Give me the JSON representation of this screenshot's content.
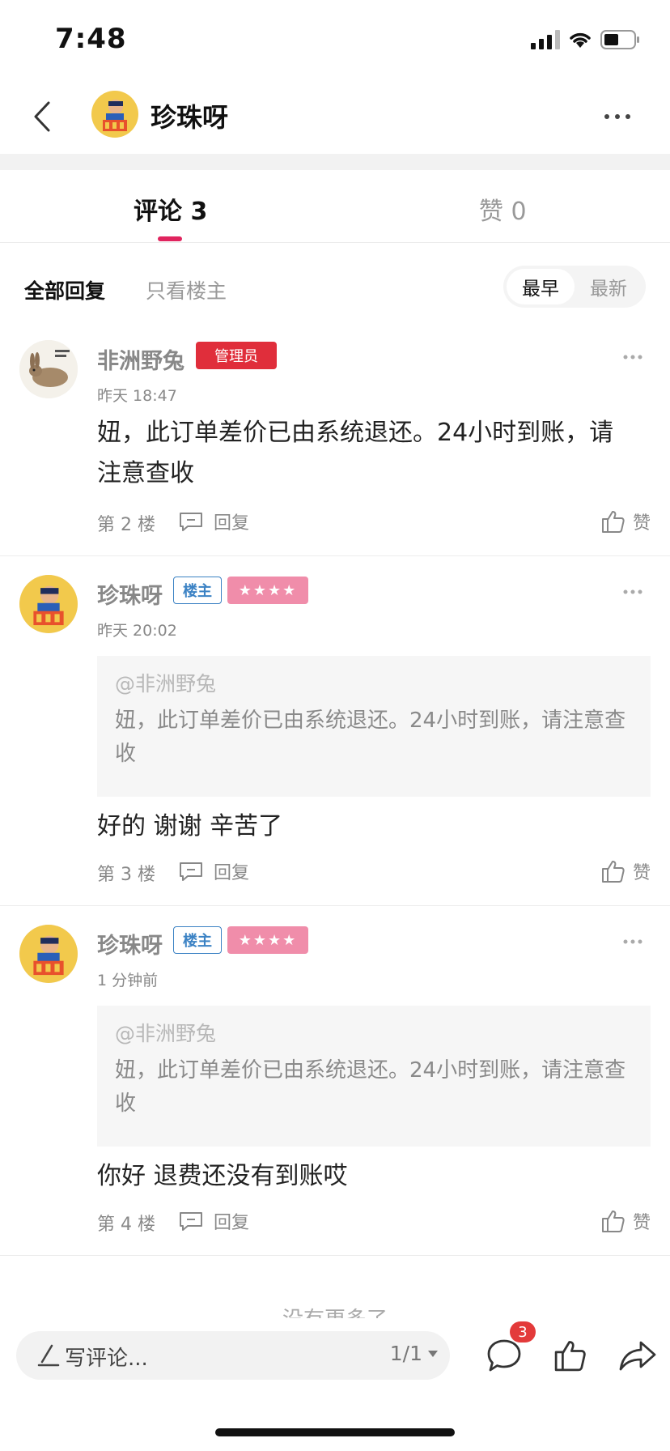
{
  "status_bar": {
    "time": "7:48"
  },
  "header": {
    "title": "珍珠呀"
  },
  "tabs": {
    "comments_label": "评论 3",
    "likes_label": "赞 0"
  },
  "filter": {
    "all_label": "全部回复",
    "op_only_label": "只看楼主",
    "sort_earliest": "最早",
    "sort_latest": "最新"
  },
  "comments": [
    {
      "author": "非洲野兔",
      "badge": "管理员",
      "time": "昨天 18:47",
      "text": "妞，此订单差价已由系统退还。24小时到账，请注意查收",
      "floor": "第 2 楼",
      "reply_label": "回复",
      "like_label": "赞"
    },
    {
      "author": "珍珠呀",
      "badge": "楼主",
      "stars": "★★★★",
      "time": "昨天 20:02",
      "quote_user": "@非洲野兔",
      "quote_text": "妞，此订单差价已由系统退还。24小时到账，请注意查收",
      "text": "好的 谢谢 辛苦了",
      "floor": "第 3 楼",
      "reply_label": "回复",
      "like_label": "赞"
    },
    {
      "author": "珍珠呀",
      "badge": "楼主",
      "stars": "★★★★",
      "time": "1 分钟前",
      "quote_user": "@非洲野兔",
      "quote_text": "妞，此订单差价已由系统退还。24小时到账，请注意查收",
      "text": "你好 退费还没有到账哎",
      "floor": "第 4 楼",
      "reply_label": "回复",
      "like_label": "赞"
    }
  ],
  "end_hint": "没有更多了",
  "bottom_bar": {
    "write_placeholder": "写评论...",
    "page_indicator": "1/1",
    "comment_badge": "3"
  },
  "colors": {
    "accent": "#e0245e",
    "admin_badge": "#e02e3b",
    "op_badge": "#3b82c4",
    "stars_badge": "#f08daa"
  }
}
